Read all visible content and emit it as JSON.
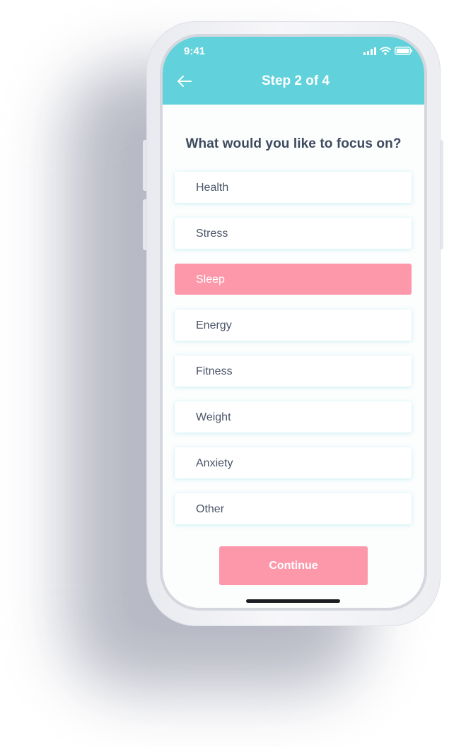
{
  "status_bar": {
    "time": "9:41",
    "icons": [
      "signal-icon",
      "wifi-icon",
      "battery-icon"
    ]
  },
  "header": {
    "title": "Step 2 of 4",
    "back_icon": "back-arrow-icon",
    "background_color": "#61d2db"
  },
  "question": "What would you like to focus on?",
  "options": [
    {
      "label": "Health",
      "selected": false
    },
    {
      "label": "Stress",
      "selected": false
    },
    {
      "label": "Sleep",
      "selected": true
    },
    {
      "label": "Energy",
      "selected": false
    },
    {
      "label": "Fitness",
      "selected": false
    },
    {
      "label": "Weight",
      "selected": false
    },
    {
      "label": "Anxiety",
      "selected": false
    },
    {
      "label": "Other",
      "selected": false
    }
  ],
  "continue_label": "Continue",
  "colors": {
    "accent": "#fd98ab",
    "header": "#61d2db",
    "text": "#4a5468"
  }
}
